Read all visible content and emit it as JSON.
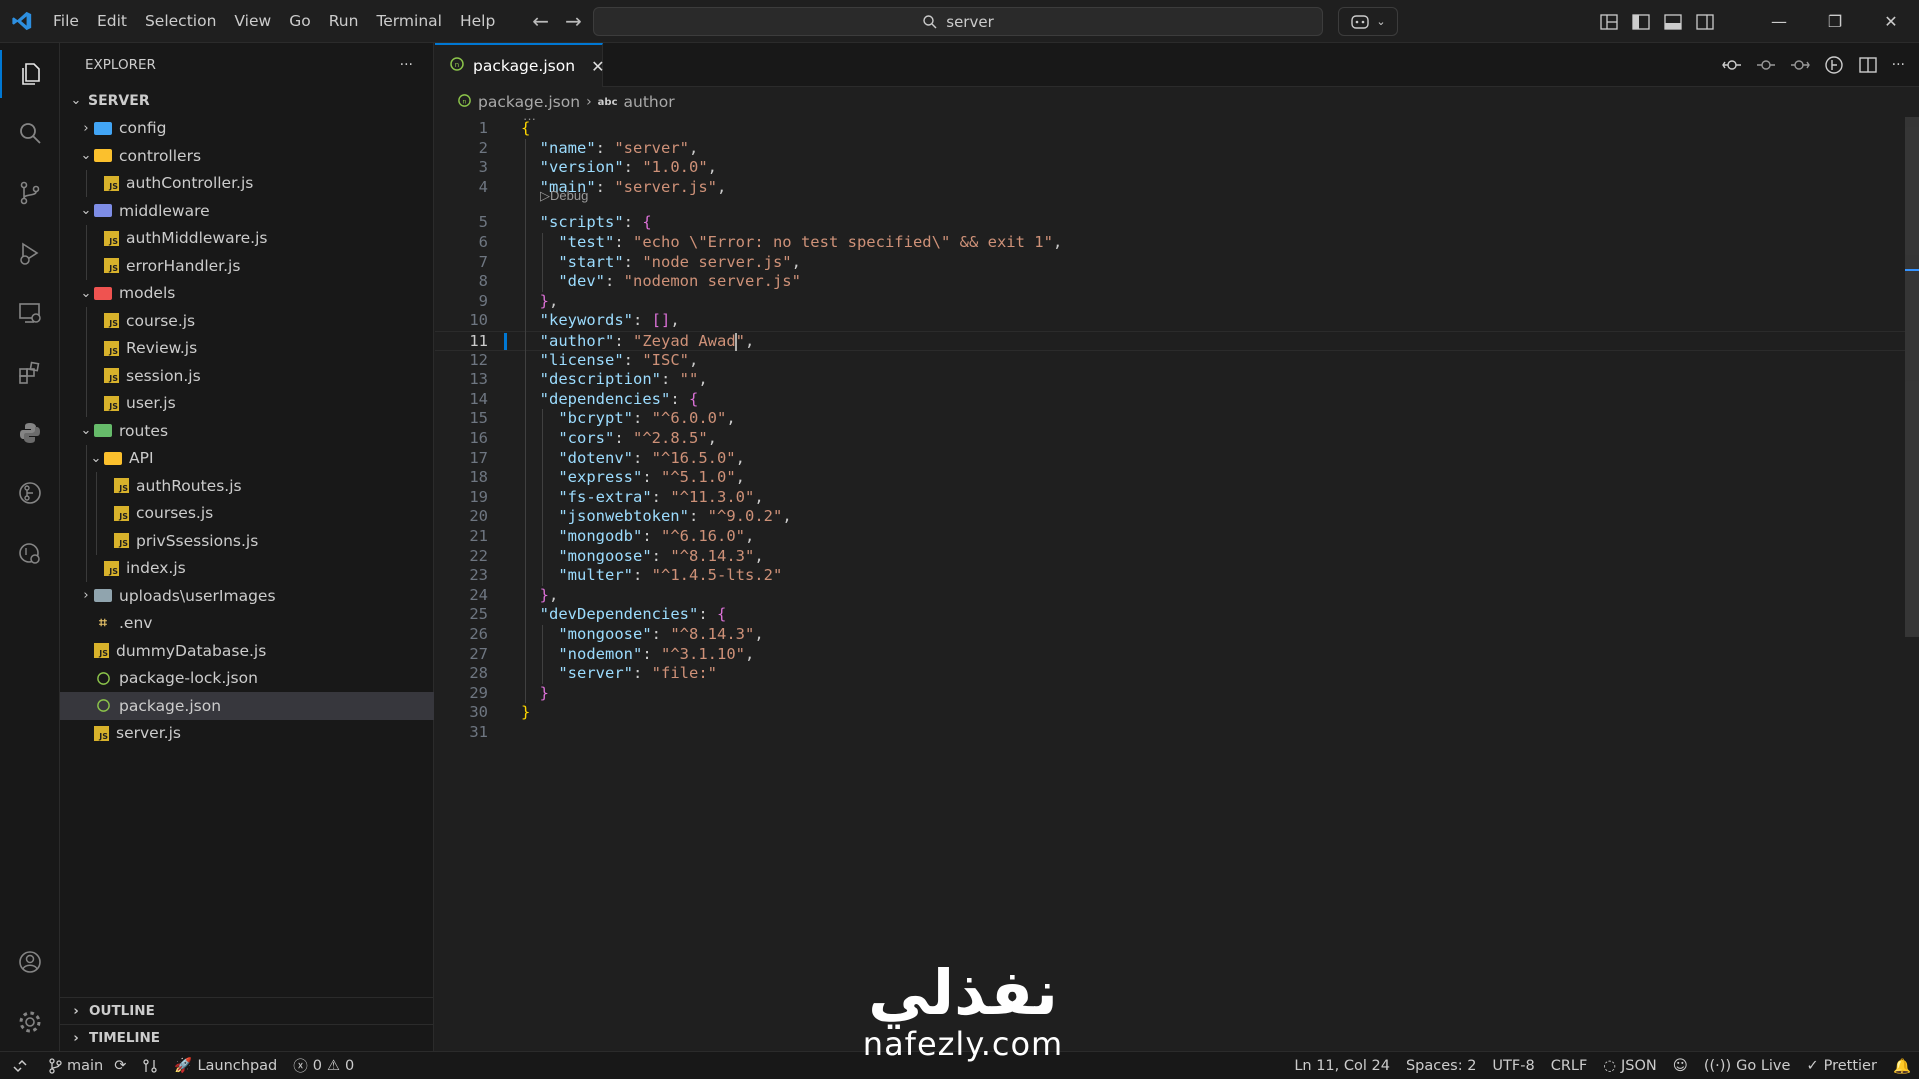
{
  "titlebar": {
    "menu": [
      "File",
      "Edit",
      "Selection",
      "View",
      "Go",
      "Run",
      "Terminal",
      "Help"
    ],
    "search_text": "server"
  },
  "sidebar": {
    "header": "EXPLORER",
    "more": "···",
    "root": "SERVER",
    "tree": [
      {
        "label": "config",
        "type": "folder",
        "open": false,
        "depth": 1,
        "color": "#42a5f5"
      },
      {
        "label": "controllers",
        "type": "folder",
        "open": true,
        "depth": 1,
        "color": "#fbc02d"
      },
      {
        "label": "authController.js",
        "type": "js",
        "depth": 2
      },
      {
        "label": "middleware",
        "type": "folder",
        "open": true,
        "depth": 1,
        "color": "#7e8de6"
      },
      {
        "label": "authMiddleware.js",
        "type": "js",
        "depth": 2
      },
      {
        "label": "errorHandler.js",
        "type": "js",
        "depth": 2
      },
      {
        "label": "models",
        "type": "folder",
        "open": true,
        "depth": 1,
        "color": "#ef5350"
      },
      {
        "label": "course.js",
        "type": "js",
        "depth": 2
      },
      {
        "label": "Review.js",
        "type": "js",
        "depth": 2
      },
      {
        "label": "session.js",
        "type": "js",
        "depth": 2
      },
      {
        "label": "user.js",
        "type": "js",
        "depth": 2
      },
      {
        "label": "routes",
        "type": "folder",
        "open": true,
        "depth": 1,
        "color": "#66bb6a"
      },
      {
        "label": "API",
        "type": "folder",
        "open": true,
        "depth": 2,
        "color": "#fbc02d"
      },
      {
        "label": "authRoutes.js",
        "type": "js",
        "depth": 3
      },
      {
        "label": "courses.js",
        "type": "js",
        "depth": 3
      },
      {
        "label": "privSsessions.js",
        "type": "js",
        "depth": 3
      },
      {
        "label": "index.js",
        "type": "js",
        "depth": 2
      },
      {
        "label": "uploads\\userImages",
        "type": "folder",
        "open": false,
        "depth": 1,
        "color": "#90a4ae"
      },
      {
        "label": ".env",
        "type": "env",
        "depth": 1
      },
      {
        "label": "dummyDatabase.js",
        "type": "js",
        "depth": 1
      },
      {
        "label": "package-lock.json",
        "type": "json",
        "depth": 1
      },
      {
        "label": "package.json",
        "type": "json",
        "depth": 1,
        "selected": true
      },
      {
        "label": "server.js",
        "type": "js",
        "depth": 1
      }
    ],
    "outline": "OUTLINE",
    "timeline": "TIMELINE"
  },
  "editor": {
    "tab_label": "package.json",
    "breadcrumb_file": "package.json",
    "breadcrumb_symbol": "author",
    "codelens": "Debug",
    "ellipsis": "···",
    "current_line": 11,
    "lines": [
      "{",
      "  \"name\": \"server\",",
      "  \"version\": \"1.0.0\",",
      "  \"main\": \"server.js\",",
      "  \"scripts\": {",
      "    \"test\": \"echo \\\"Error: no test specified\\\" && exit 1\",",
      "    \"start\": \"node server.js\",",
      "    \"dev\": \"nodemon server.js\"",
      "  },",
      "  \"keywords\": [],",
      "  \"author\": \"Zeyad Awad\",",
      "  \"license\": \"ISC\",",
      "  \"description\": \"\",",
      "  \"dependencies\": {",
      "    \"bcrypt\": \"^6.0.0\",",
      "    \"cors\": \"^2.8.5\",",
      "    \"dotenv\": \"^16.5.0\",",
      "    \"express\": \"^5.1.0\",",
      "    \"fs-extra\": \"^11.3.0\",",
      "    \"jsonwebtoken\": \"^9.0.2\",",
      "    \"mongodb\": \"^6.16.0\",",
      "    \"mongoose\": \"^8.14.3\",",
      "    \"multer\": \"^1.4.5-lts.2\"",
      "  },",
      "  \"devDependencies\": {",
      "    \"mongoose\": \"^8.14.3\",",
      "    \"nodemon\": \"^3.1.10\",",
      "    \"server\": \"file:\"",
      "  }",
      "}",
      ""
    ]
  },
  "statusbar": {
    "branch": "main",
    "launchpad": "Launchpad",
    "errors": "0",
    "warnings": "0",
    "position": "Ln 11, Col 24",
    "spaces": "Spaces: 2",
    "encoding": "UTF-8",
    "eol": "CRLF",
    "language": "JSON",
    "golive": "Go Live",
    "prettier": "Prettier"
  },
  "watermark": {
    "arabic": "نفذلي",
    "latin": "nafezly.com"
  },
  "colors": {
    "accent": "#0078d4",
    "js_icon": "#d8b22b",
    "json_icon": "#8bc34a"
  }
}
